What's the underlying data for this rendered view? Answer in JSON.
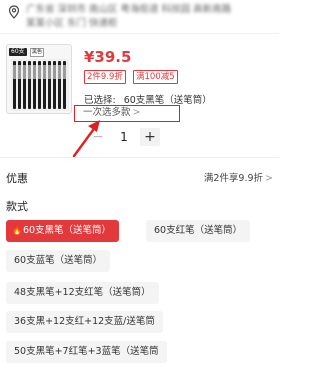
{
  "address": {
    "line1": "广东省 深圳市 南山区 粤海街道 科技园 高新南路",
    "line2": "某某小区 东门 快递柜"
  },
  "product": {
    "tag": "60支",
    "tag2": "黑色",
    "price": "¥39.5",
    "badges": [
      "2件9.9折",
      "满100减5"
    ],
    "selected_label": "已选择:",
    "selected_value": "60支黑笔（送笔筒）",
    "multi_select_label": "一次选多款",
    "multi_select_chevron": ">"
  },
  "quantity": {
    "minus": "−",
    "value": "1",
    "plus": "+"
  },
  "promo": {
    "label": "优惠",
    "value": "满2件享9.9折",
    "chevron": ">"
  },
  "styles": {
    "label": "款式",
    "options": [
      {
        "label": "60支黑笔（送笔筒）",
        "selected": true
      },
      {
        "label": "60支红笔（送笔筒）",
        "selected": false
      },
      {
        "label": "60支蓝笔（送笔筒）",
        "selected": false
      },
      {
        "label": "48支黑笔+12支红笔（送笔筒）",
        "selected": false
      },
      {
        "label": "36支黑+12支红+12支蓝/送笔筒",
        "selected": false
      },
      {
        "label": "50支黑笔+7红笔+3蓝笔（送笔筒",
        "selected": false
      }
    ]
  },
  "colors": {
    "accent": "#e4393c",
    "annotation": "#e02020",
    "option_bg": "#f4f4f4"
  }
}
